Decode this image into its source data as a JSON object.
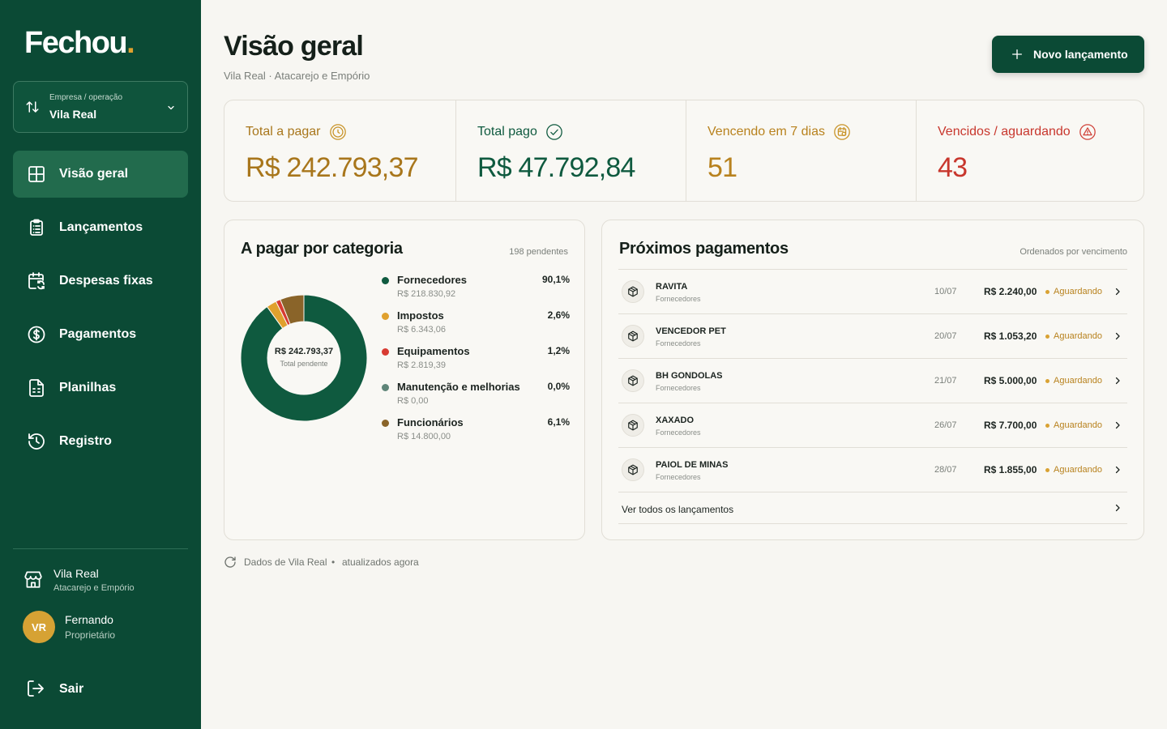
{
  "brand": {
    "name": "Fechou",
    "dot": ".",
    "accent": "#e0a12e",
    "primary": "#0b4a35"
  },
  "company_select": {
    "label": "Empresa / operação",
    "value": "Vila Real"
  },
  "nav": [
    {
      "label": "Visão geral",
      "icon": "grid-icon",
      "active": true
    },
    {
      "label": "Lançamentos",
      "icon": "clipboard-icon"
    },
    {
      "label": "Despesas fixas",
      "icon": "calendar-repeat-icon"
    },
    {
      "label": "Pagamentos",
      "icon": "dollar-circle-icon"
    },
    {
      "label": "Planilhas",
      "icon": "spreadsheet-icon"
    },
    {
      "label": "Registro",
      "icon": "history-icon"
    }
  ],
  "store": {
    "name": "Vila Real",
    "subtitle": "Atacarejo e Empório"
  },
  "user": {
    "initials": "VR",
    "name": "Fernando",
    "role": "Proprietário"
  },
  "logout_label": "Sair",
  "header": {
    "title": "Visão geral",
    "subtitle": "Vila Real · Atacarejo e Empório",
    "new_button": "Novo lançamento"
  },
  "kpis": [
    {
      "label": "Total a pagar",
      "value": "R$ 242.793,37",
      "color": "#a8761b",
      "icon": "clock-icon"
    },
    {
      "label": "Total pago",
      "value": "R$ 47.792,84",
      "color": "#0f5a3f",
      "icon": "check-circle-icon"
    },
    {
      "label": "Vencendo em 7 dias",
      "value": "51",
      "color": "#b8821e",
      "icon": "calendar-clock-icon"
    },
    {
      "label": "Vencidos / aguardando",
      "value": "43",
      "color": "#c8372d",
      "icon": "alert-triangle-icon"
    }
  ],
  "category_panel": {
    "title": "A pagar por categoria",
    "meta": "198 pendentes",
    "center_value": "R$ 242.793,37",
    "center_label": "Total pendente",
    "items": [
      {
        "name": "Fornecedores",
        "amount": "R$ 218.830,92",
        "percent": "90,1%",
        "share": 90.1,
        "color": "#0f5a3f"
      },
      {
        "name": "Impostos",
        "amount": "R$ 6.343,06",
        "percent": "2,6%",
        "share": 2.6,
        "color": "#e0a12e"
      },
      {
        "name": "Equipamentos",
        "amount": "R$ 2.819,39",
        "percent": "1,2%",
        "share": 1.2,
        "color": "#d83b32"
      },
      {
        "name": "Manutenção e melhorias",
        "amount": "R$ 0,00",
        "percent": "0,0%",
        "share": 0.0,
        "color": "#5f8578"
      },
      {
        "name": "Funcionários",
        "amount": "R$ 14.800,00",
        "percent": "6,1%",
        "share": 6.1,
        "color": "#8a6429"
      }
    ]
  },
  "payments_panel": {
    "title": "Próximos pagamentos",
    "meta": "Ordenados por vencimento",
    "rows": [
      {
        "name": "RAVITA",
        "category": "Fornecedores",
        "date": "10/07",
        "amount": "R$ 2.240,00",
        "status": "Aguardando"
      },
      {
        "name": "VENCEDOR PET",
        "category": "Fornecedores",
        "date": "20/07",
        "amount": "R$ 1.053,20",
        "status": "Aguardando"
      },
      {
        "name": "BH GONDOLAS",
        "category": "Fornecedores",
        "date": "21/07",
        "amount": "R$ 5.000,00",
        "status": "Aguardando"
      },
      {
        "name": "XAXADO",
        "category": "Fornecedores",
        "date": "26/07",
        "amount": "R$ 7.700,00",
        "status": "Aguardando"
      },
      {
        "name": "PAIOL DE MINAS",
        "category": "Fornecedores",
        "date": "28/07",
        "amount": "R$ 1.855,00",
        "status": "Aguardando"
      }
    ],
    "see_all": "Ver todos os lançamentos"
  },
  "footer": {
    "source": "Dados de Vila Real",
    "separator": "•",
    "updated": "atualizados agora"
  }
}
